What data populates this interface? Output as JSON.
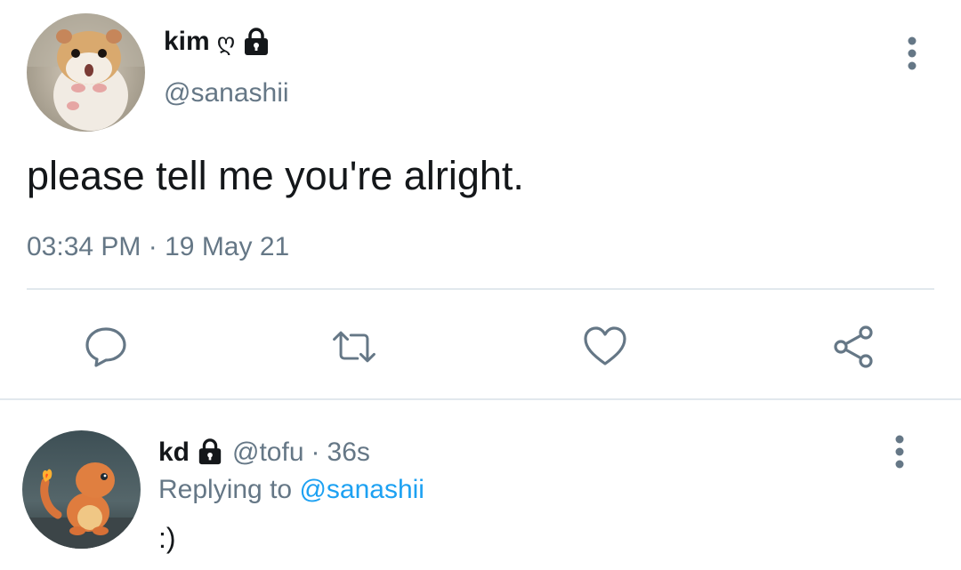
{
  "main_tweet": {
    "author": {
      "name": "kim",
      "name_emoji": "ღ",
      "handle": "@sanashii",
      "avatar_icon": "hamster-avatar"
    },
    "text": "please tell me you're alright.",
    "time": "03:34 PM",
    "date": "19 May 21",
    "time_separator": "·"
  },
  "actions": {
    "reply_icon": "reply-icon",
    "retweet_icon": "retweet-icon",
    "like_icon": "like-icon",
    "share_icon": "share-icon"
  },
  "reply": {
    "author": {
      "name": "kd",
      "handle": "@tofu",
      "avatar_icon": "charmander-avatar"
    },
    "separator": "·",
    "time": "36s",
    "replying_label": "Replying to",
    "replying_to": "@sanashii",
    "text": ":)"
  },
  "colors": {
    "text_primary": "#14171a",
    "text_secondary": "#657786",
    "accent": "#1da1f2",
    "divider": "#e1e8ed"
  }
}
